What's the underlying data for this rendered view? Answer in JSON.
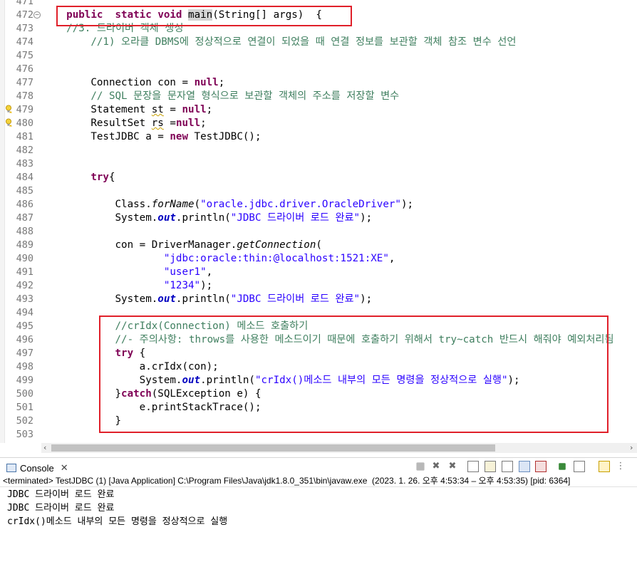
{
  "editor": {
    "lines": [
      {
        "n": "471",
        "segs": []
      },
      {
        "n": "472",
        "fold": true,
        "segs": [
          [
            "kw",
            "public"
          ],
          [
            "",
            "  "
          ],
          [
            "kw",
            "static"
          ],
          [
            "",
            " "
          ],
          [
            "kw",
            "void"
          ],
          [
            "",
            " "
          ],
          [
            "hl",
            "main"
          ],
          [
            "",
            "(String[] args)  {"
          ]
        ],
        "indent": "    "
      },
      {
        "n": "473",
        "segs": [
          [
            "cm",
            "//3. 드라이버 객체 생성"
          ]
        ],
        "indent": "    "
      },
      {
        "n": "474",
        "segs": [
          [
            "cm",
            "//1) 오라클 DBMS에 정상적으로 연결이 되었을 때 연결 정보를 보관할 객체 참조 변수 선언"
          ]
        ],
        "indent": "        "
      },
      {
        "n": "475",
        "segs": []
      },
      {
        "n": "476",
        "segs": []
      },
      {
        "n": "477",
        "segs": [
          [
            "",
            "Connection con = "
          ],
          [
            "kw",
            "null"
          ],
          [
            "",
            ";"
          ]
        ],
        "indent": "        "
      },
      {
        "n": "478",
        "segs": [
          [
            "cm",
            "// SQL 문장을 문자열 형식으로 보관할 객체의 주소를 저장할 변수"
          ]
        ],
        "indent": "        "
      },
      {
        "n": "479",
        "warn": true,
        "segs": [
          [
            "",
            "Statement "
          ],
          [
            "wu",
            "st"
          ],
          [
            "",
            " = "
          ],
          [
            "kw",
            "null"
          ],
          [
            "",
            ";"
          ]
        ],
        "indent": "        "
      },
      {
        "n": "480",
        "warn": true,
        "segs": [
          [
            "",
            "ResultSet "
          ],
          [
            "wu",
            "rs"
          ],
          [
            "",
            " ="
          ],
          [
            "kw",
            "null"
          ],
          [
            "",
            ";"
          ]
        ],
        "indent": "        "
      },
      {
        "n": "481",
        "segs": [
          [
            "",
            "TestJDBC a = "
          ],
          [
            "kw",
            "new"
          ],
          [
            "",
            " TestJDBC();"
          ]
        ],
        "indent": "        "
      },
      {
        "n": "482",
        "segs": []
      },
      {
        "n": "483",
        "segs": []
      },
      {
        "n": "484",
        "segs": [
          [
            "kw",
            "try"
          ],
          [
            "",
            "{"
          ]
        ],
        "indent": "        "
      },
      {
        "n": "485",
        "segs": []
      },
      {
        "n": "486",
        "segs": [
          [
            "",
            "Class."
          ],
          [
            "it",
            "forName"
          ],
          [
            "",
            "("
          ],
          [
            "str",
            "\"oracle.jdbc.driver.OracleDriver\""
          ],
          [
            "",
            ");"
          ]
        ],
        "indent": "            "
      },
      {
        "n": "487",
        "segs": [
          [
            "",
            "System."
          ],
          [
            "fld",
            "out"
          ],
          [
            "",
            ".println("
          ],
          [
            "str",
            "\"JDBC 드라이버 로드 완료\""
          ],
          [
            "",
            ");"
          ]
        ],
        "indent": "            "
      },
      {
        "n": "488",
        "segs": []
      },
      {
        "n": "489",
        "segs": [
          [
            "",
            "con = DriverManager."
          ],
          [
            "it",
            "getConnection"
          ],
          [
            "",
            "("
          ]
        ],
        "indent": "            "
      },
      {
        "n": "490",
        "segs": [
          [
            "str",
            "\"jdbc:oracle:thin:@localhost:1521:XE\""
          ],
          [
            "",
            ","
          ]
        ],
        "indent": "                    "
      },
      {
        "n": "491",
        "segs": [
          [
            "str",
            "\"user1\""
          ],
          [
            "",
            ","
          ]
        ],
        "indent": "                    "
      },
      {
        "n": "492",
        "segs": [
          [
            "str",
            "\"1234\""
          ],
          [
            "",
            ");"
          ]
        ],
        "indent": "                    "
      },
      {
        "n": "493",
        "segs": [
          [
            "",
            "System."
          ],
          [
            "fld",
            "out"
          ],
          [
            "",
            ".println("
          ],
          [
            "str",
            "\"JDBC 드라이버 로드 완료\""
          ],
          [
            "",
            ");"
          ]
        ],
        "indent": "            "
      },
      {
        "n": "494",
        "segs": []
      },
      {
        "n": "495",
        "segs": [
          [
            "cm",
            "//crIdx(Connection) 메소드 호출하기"
          ]
        ],
        "indent": "            "
      },
      {
        "n": "496",
        "segs": [
          [
            "cm",
            "//- 주의사항: throws를 사용한 메소드이기 때문에 호출하기 위해서 try~catch 반드시 해줘야 예외처리됨"
          ]
        ],
        "indent": "            "
      },
      {
        "n": "497",
        "segs": [
          [
            "kw",
            "try"
          ],
          [
            "",
            " {"
          ]
        ],
        "indent": "            "
      },
      {
        "n": "498",
        "segs": [
          [
            "",
            "a.crIdx(con);"
          ]
        ],
        "indent": "                "
      },
      {
        "n": "499",
        "segs": [
          [
            "",
            "System."
          ],
          [
            "fld",
            "out"
          ],
          [
            "",
            ".println("
          ],
          [
            "str",
            "\"crIdx()메소드 내부의 모든 명령을 정상적으로 실행\""
          ],
          [
            "",
            ");"
          ]
        ],
        "indent": "                "
      },
      {
        "n": "500",
        "segs": [
          [
            "",
            "}"
          ],
          [
            "kw",
            "catch"
          ],
          [
            "",
            "(SQLException e) {"
          ]
        ],
        "indent": "            "
      },
      {
        "n": "501",
        "segs": [
          [
            "",
            "e.printStackTrace();"
          ]
        ],
        "indent": "                "
      },
      {
        "n": "502",
        "segs": [
          [
            "",
            "}"
          ]
        ],
        "indent": "            "
      },
      {
        "n": "503",
        "segs": []
      }
    ]
  },
  "console": {
    "tab_label": "Console",
    "status": "<terminated> TestJDBC (1) [Java Application] C:\\Program Files\\Java\\jdk1.8.0_351\\bin\\javaw.exe  (2023. 1. 26. 오후 4:53:34 – 오후 4:53:35) [pid: 6364]",
    "output": [
      "JDBC 드라이버 로드 완료",
      "JDBC 드라이버 로드 완료",
      "crIdx()메소드 내부의 모든 명령을 정상적으로 실행"
    ]
  },
  "colors": {
    "keyword": "#7f0055",
    "string": "#2a00ff",
    "comment": "#3f7f5f",
    "field": "#0000c0",
    "highlight_box": "#e0202a"
  },
  "toolbar_icons": [
    "terminate-icon",
    "remove-launch-icon",
    "remove-all-terminated-icon",
    "copy-icon",
    "scroll-lock-icon",
    "word-wrap-icon",
    "show-on-stdout-icon",
    "show-on-stderr-icon",
    "pin-console-icon",
    "display-selected-console-icon",
    "open-console-icon",
    "view-menu-icon"
  ]
}
